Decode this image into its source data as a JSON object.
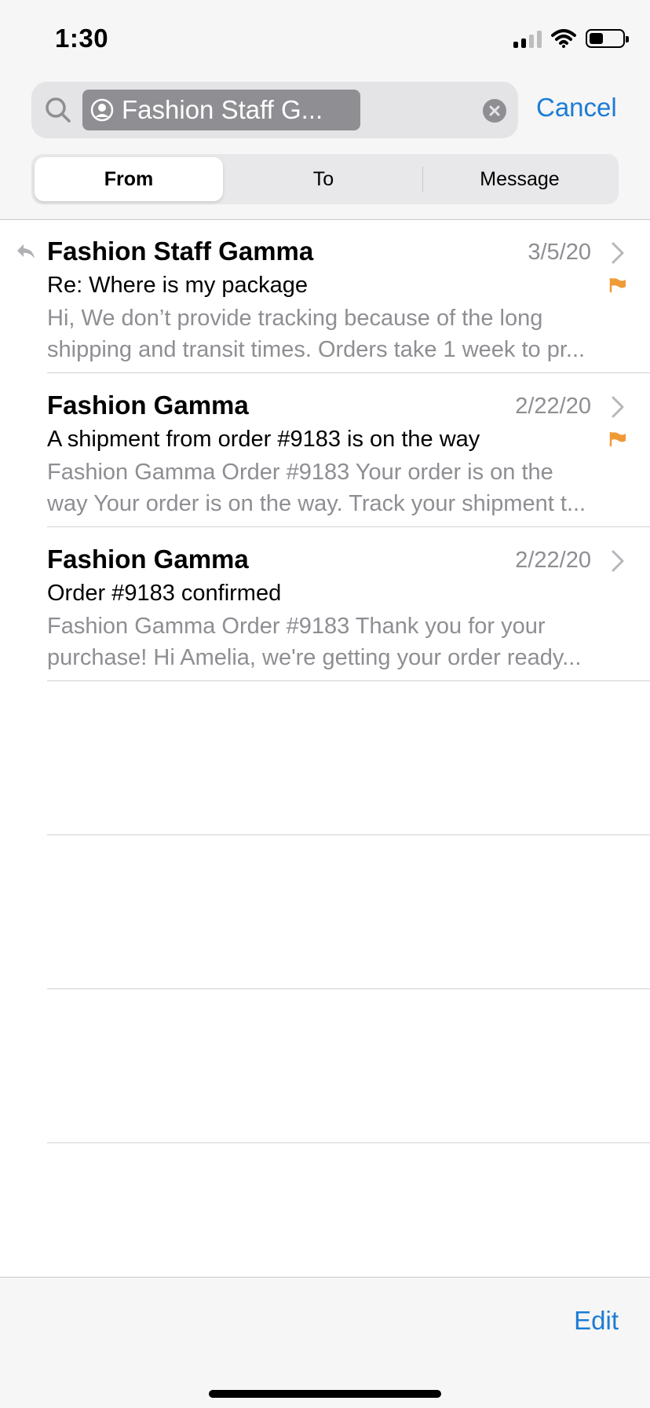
{
  "status_bar": {
    "time": "1:30"
  },
  "search": {
    "token_label": "Fashion Staff G...",
    "cancel_label": "Cancel"
  },
  "scope": {
    "tabs": [
      {
        "label": "From",
        "selected": true
      },
      {
        "label": "To",
        "selected": false
      },
      {
        "label": "Message",
        "selected": false
      }
    ]
  },
  "messages": [
    {
      "sender": "Fashion Staff Gamma",
      "date": "3/5/20",
      "subject": "Re: Where is my package",
      "preview_line1": "Hi, We don’t provide tracking because of the long",
      "preview_line2": "shipping and transit times. Orders take 1 week to pr...",
      "replied": true,
      "flagged": true
    },
    {
      "sender": "Fashion Gamma",
      "date": "2/22/20",
      "subject": "A shipment from order #9183 is on the way",
      "preview_line1": "Fashion Gamma Order #9183 Your order is on the",
      "preview_line2": "way Your order is on the way. Track your shipment t...",
      "replied": false,
      "flagged": true
    },
    {
      "sender": "Fashion Gamma",
      "date": "2/22/20",
      "subject": "Order #9183 confirmed",
      "preview_line1": "Fashion Gamma Order #9183 Thank you for your",
      "preview_line2": "purchase! Hi Amelia, we're getting your order ready...",
      "replied": false,
      "flagged": false
    }
  ],
  "toolbar": {
    "edit_label": "Edit"
  },
  "colors": {
    "accent": "#1c7cd5",
    "flag": "#f09a37",
    "secondary_text": "#8e8e93"
  }
}
